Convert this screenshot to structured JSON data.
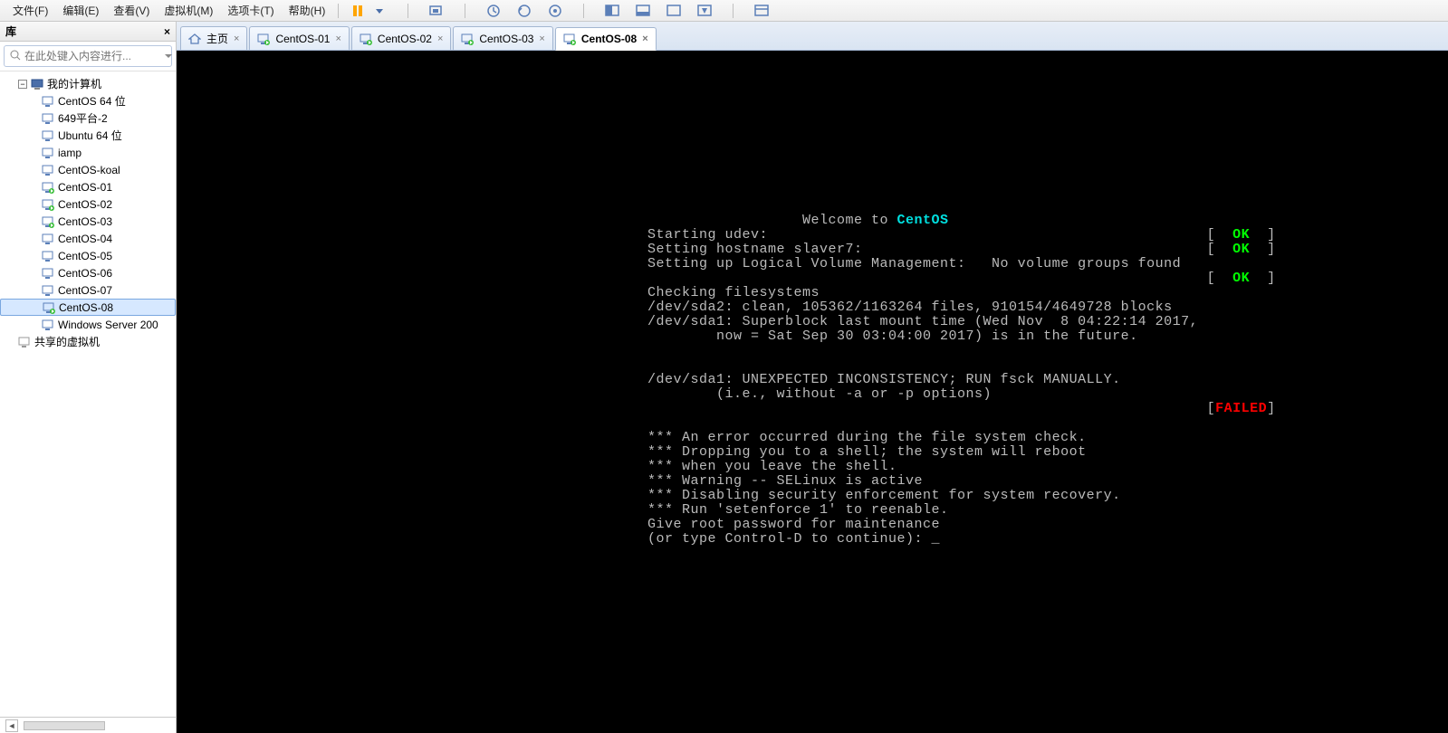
{
  "menu": [
    "文件(F)",
    "编辑(E)",
    "查看(V)",
    "虚拟机(M)",
    "选项卡(T)",
    "帮助(H)"
  ],
  "panel": {
    "title": "库",
    "close": "×",
    "search_placeholder": "在此处键入内容进行..."
  },
  "tree": {
    "root": "我的计算机",
    "items": [
      "CentOS 64 位",
      "649平台-2",
      "Ubuntu 64 位",
      "iamp",
      "CentOS-koal",
      "CentOS-01",
      "CentOS-02",
      "CentOS-03",
      "CentOS-04",
      "CentOS-05",
      "CentOS-06",
      "CentOS-07",
      "CentOS-08",
      "Windows Server 200"
    ],
    "shared": "共享的虚拟机",
    "selected": "CentOS-08",
    "running": [
      "CentOS-01",
      "CentOS-02",
      "CentOS-03",
      "CentOS-08"
    ]
  },
  "tabs": {
    "home": "主页",
    "list": [
      "CentOS-01",
      "CentOS-02",
      "CentOS-03",
      "CentOS-08"
    ],
    "active": "CentOS-08"
  },
  "console": {
    "welcome_pre": "                  Welcome to ",
    "welcome_os": "CentOS",
    "line1": "Starting udev:                                                   [  ",
    "ok": "OK",
    "line1_end": "  ]",
    "line2": "Setting hostname slaver7:                                        [  ",
    "line3": "Setting up Logical Volume Management:   No volume groups found",
    "line3b": "                                                                 [  ",
    "line4": "Checking filesystems",
    "line5": "/dev/sda2: clean, 105362/1163264 files, 910154/4649728 blocks",
    "line6": "/dev/sda1: Superblock last mount time (Wed Nov  8 04:22:14 2017,",
    "line7": "        now = Sat Sep 30 03:04:00 2017) is in the future.",
    "line8": "/dev/sda1: UNEXPECTED INCONSISTENCY; RUN fsck MANUALLY.",
    "line9": "        (i.e., without -a or -p options)",
    "failed_pre": "                                                                 [",
    "failed": "FAILED",
    "failed_end": "]",
    "line10": "*** An error occurred during the file system check.",
    "line11": "*** Dropping you to a shell; the system will reboot",
    "line12": "*** when you leave the shell.",
    "line13": "*** Warning -- SELinux is active",
    "line14": "*** Disabling security enforcement for system recovery.",
    "line15": "*** Run 'setenforce 1' to reenable.",
    "line16": "Give root password for maintenance",
    "line17": "(or type Control-D to continue): _"
  }
}
